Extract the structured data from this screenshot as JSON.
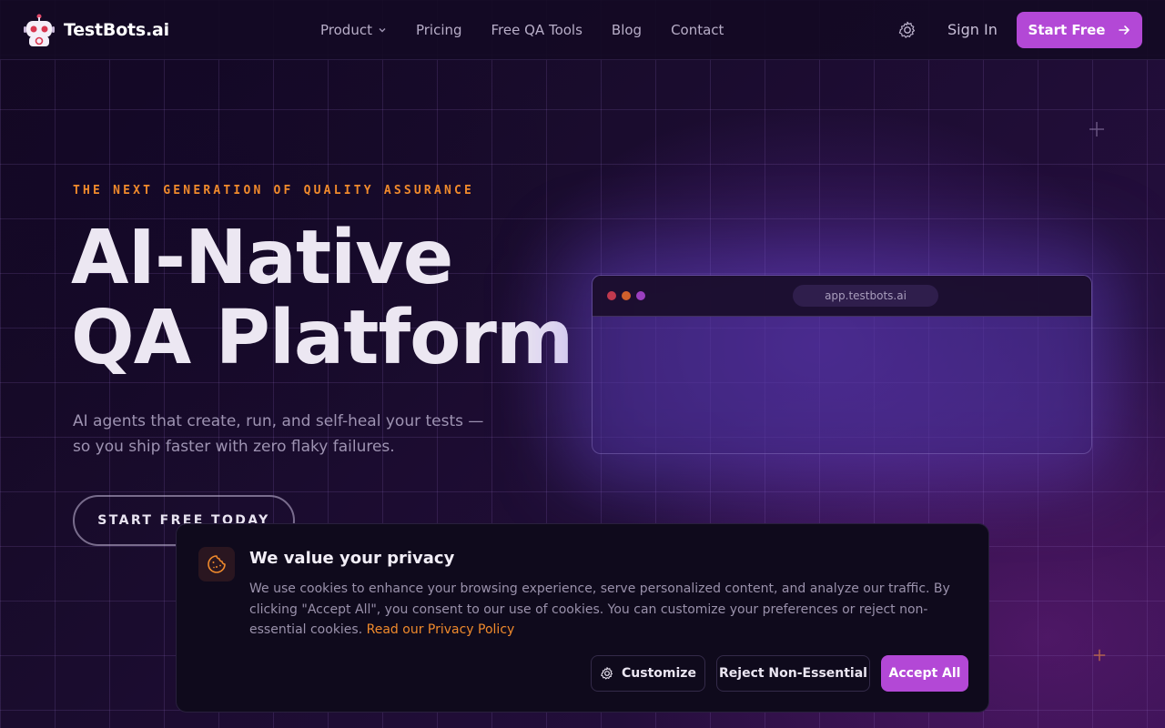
{
  "brand": {
    "name": "TestBots.ai"
  },
  "nav": {
    "links": [
      {
        "label": "Product",
        "has_dropdown": true
      },
      {
        "label": "Pricing"
      },
      {
        "label": "Free QA Tools"
      },
      {
        "label": "Blog"
      },
      {
        "label": "Contact"
      }
    ],
    "settings_icon": "gear-icon",
    "sign_in": "Sign In",
    "start_free": "Start Free",
    "start_free_icon": "arrow-right-icon"
  },
  "hero": {
    "eyebrow": "THE NEXT GENERATION OF QUALITY ASSURANCE",
    "headline_line1": "AI-Native",
    "headline_line2": "QA Platform",
    "subtitle": "AI agents that create, run, and self-heal your tests — so you ship faster with zero flaky failures.",
    "cta": "START FREE TODAY"
  },
  "browser_mock": {
    "url": "app.testbots.ai"
  },
  "cookie_banner": {
    "icon": "cookie-icon",
    "title": "We value your privacy",
    "text": "We use cookies to enhance your browsing experience, serve personalized content, and analyze our traffic. By clicking \"Accept All\", you consent to our use of cookies. You can customize your preferences or reject non-essential cookies. ",
    "link": "Read our Privacy Policy",
    "customize": "Customize",
    "reject": "Reject Non-Essential",
    "accept": "Accept All"
  },
  "colors": {
    "accent": "#b348d6",
    "orange": "#f08a2c",
    "background": "#140a22"
  }
}
